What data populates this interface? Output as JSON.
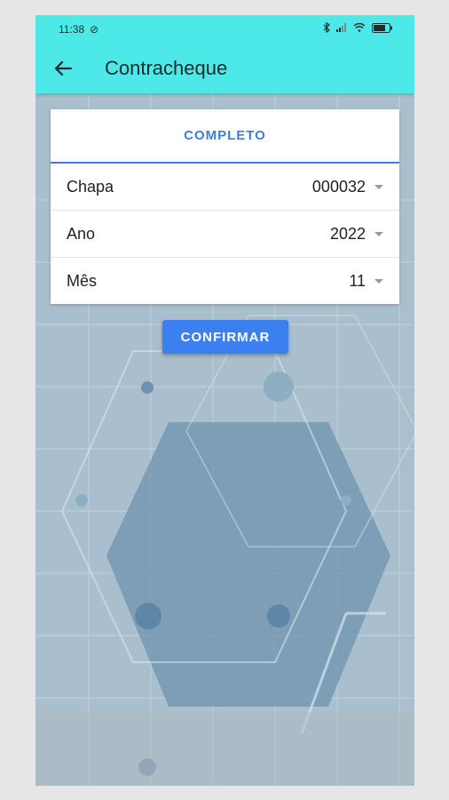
{
  "status_bar": {
    "time": "11:38"
  },
  "appbar": {
    "title": "Contracheque",
    "back_icon": "arrow-left-icon"
  },
  "form": {
    "tab_label": "COMPLETO",
    "rows": [
      {
        "label": "Chapa",
        "value": "000032"
      },
      {
        "label": "Ano",
        "value": "2022"
      },
      {
        "label": "Mês",
        "value": "11"
      }
    ]
  },
  "actions": {
    "confirm_label": "CONFIRMAR"
  },
  "colors": {
    "appbar": "#4de8e8",
    "accent": "#3d7fd8",
    "button": "#3a80f0"
  }
}
